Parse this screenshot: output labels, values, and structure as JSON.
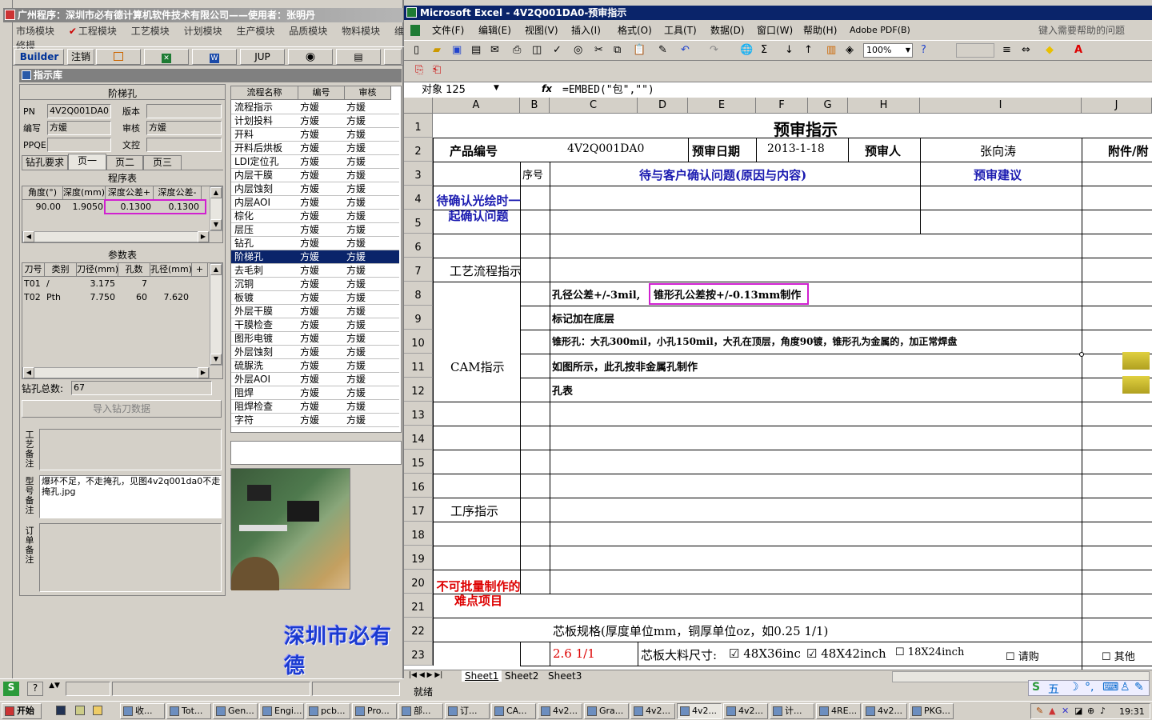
{
  "left": {
    "title": "广州程序：深圳市必有德计算机软件技术有限公司——使用者：张明丹",
    "menu": [
      "市场模块",
      "工程模块",
      "工艺模块",
      "计划模块",
      "生产模块",
      "品质模块",
      "物料模块",
      "维修模"
    ],
    "toolbar": {
      "builder": "Builder",
      "logout": "注销",
      "jup": "JUP"
    },
    "library_title": "指示库",
    "hole_title": "阶梯孔",
    "pn_label": "PN",
    "pn_value": "4V2Q001DA0",
    "version_label": "版本",
    "writer_label": "编写",
    "writer_value": "方媛",
    "reviewer_label": "审核",
    "reviewer_value": "方媛",
    "ppqe_label": "PPQE",
    "doc_label": "文控",
    "tabs": [
      "钻孔要求",
      "页一",
      "页二",
      "页三"
    ],
    "prog_title": "程序表",
    "prog_headers": [
      "角度(°)",
      "深度(mm)",
      "深度公差+",
      "深度公差-"
    ],
    "prog_row": [
      "90.00",
      "1.9050",
      "0.1300",
      "0.1300"
    ],
    "param_title": "参数表",
    "param_headers": [
      "刀号",
      "类别",
      "刀径(mm)",
      "孔数",
      "孔径(mm)",
      "+"
    ],
    "param_rows": [
      [
        "T01",
        "/",
        "3.175",
        "7",
        ""
      ],
      [
        "T02",
        "Pth",
        "7.750",
        "60",
        "7.620"
      ]
    ],
    "drill_total_label": "钻孔总数:",
    "drill_total": "67",
    "import_button": "导入钻刀数据",
    "remark_labels": [
      "工艺备注",
      "型号备注",
      "订单备注"
    ],
    "model_remark": "爆环不足，不走掩孔，见图4v2q001da0不走掩孔.jpg",
    "flow_headers": [
      "流程名称",
      "编号",
      "审核"
    ],
    "flow": [
      [
        "流程指示",
        "方媛",
        "方媛"
      ],
      [
        "计划投料",
        "方媛",
        "方媛"
      ],
      [
        "开料",
        "方媛",
        "方媛"
      ],
      [
        "开料后烘板",
        "方媛",
        "方媛"
      ],
      [
        "LDI定位孔",
        "方媛",
        "方媛"
      ],
      [
        "内层干膜",
        "方媛",
        "方媛"
      ],
      [
        "内层蚀刻",
        "方媛",
        "方媛"
      ],
      [
        "内层AOI",
        "方媛",
        "方媛"
      ],
      [
        "棕化",
        "方媛",
        "方媛"
      ],
      [
        "层压",
        "方媛",
        "方媛"
      ],
      [
        "钻孔",
        "方媛",
        "方媛"
      ],
      [
        "阶梯孔",
        "方媛",
        "方媛"
      ],
      [
        "去毛刺",
        "方媛",
        "方媛"
      ],
      [
        "沉铜",
        "方媛",
        "方媛"
      ],
      [
        "板镀",
        "方媛",
        "方媛"
      ],
      [
        "外层干膜",
        "方媛",
        "方媛"
      ],
      [
        "干膜检查",
        "方媛",
        "方媛"
      ],
      [
        "图形电镀",
        "方媛",
        "方媛"
      ],
      [
        "外层蚀刻",
        "方媛",
        "方媛"
      ],
      [
        "硫脲洗",
        "方媛",
        "方媛"
      ],
      [
        "外层AOI",
        "方媛",
        "方媛"
      ],
      [
        "阻焊",
        "方媛",
        "方媛"
      ],
      [
        "阻焊检查",
        "方媛",
        "方媛"
      ],
      [
        "字符",
        "方媛",
        "方媛"
      ]
    ],
    "selected_flow_index": 11,
    "company_watermark": "深圳市必有德"
  },
  "excel": {
    "title": "Microsoft Excel - 4V2Q001DA0-预审指示",
    "menu": [
      "文件(F)",
      "编辑(E)",
      "视图(V)",
      "插入(I)",
      "格式(O)",
      "工具(T)",
      "数据(D)",
      "窗口(W)",
      "帮助(H)",
      "Adobe PDF(B)"
    ],
    "help_placeholder": "键入需要帮助的问题",
    "zoom": "100%",
    "name_box": "对象 125",
    "formula": "=EMBED(\"包\",\"\")",
    "columns": [
      "A",
      "B",
      "C",
      "D",
      "E",
      "F",
      "G",
      "H",
      "I",
      "J"
    ],
    "rows": [
      "1",
      "2",
      "3",
      "4",
      "5",
      "6",
      "7",
      "8",
      "9",
      "10",
      "11",
      "12",
      "13",
      "14",
      "15",
      "16",
      "17",
      "18",
      "19",
      "20",
      "21",
      "22",
      "23"
    ],
    "sheet_title": "预审指示",
    "product_no_label": "产品编号",
    "product_no": "4V2Q001DA0",
    "review_date_label": "预审日期",
    "review_date": "2013-1-18",
    "reviewer_label": "预审人",
    "reviewer": "张向涛",
    "attach_label": "附件/附",
    "seq_label": "序号",
    "confirm_issue_label": "待与客户确认问题(原因与内容)",
    "suggest_label": "预审建议",
    "pending_label": "待确认光绘时一起确认问题",
    "flow_label": "工艺流程指示",
    "cam_label": "CAM指示",
    "cam_items": [
      "孔径公差+/-3mil,",
      "标记加在底层",
      "锥形孔：大孔300mil，小孔150mil，大孔在顶层，角度90镀，锥形孔为金属的，加正常焊盘",
      "如图所示，此孔按非金属孔制作",
      "孔表"
    ],
    "cam_item1_extra": "锥形孔公差按+/-0.13mm制作",
    "process_label": "工序指示",
    "difficult_label": "不可批量制作的难点项目",
    "core_spec_label": "芯板规格(厚度单位mm，铜厚单位oz，如0.25 1/1)",
    "core_spec_value": "2.6 1/1",
    "core_size_label": "芯板大料尺寸:",
    "core_options": [
      "48X36inc",
      "48X42inch",
      "18X24inch",
      "请购",
      "其他"
    ],
    "sheets": [
      "Sheet1",
      "Sheet2",
      "Sheet3"
    ],
    "status": "就绪",
    "ime": "五"
  },
  "taskbar": {
    "start": "开始",
    "items": [
      "收...",
      "Tot...",
      "Gen...",
      "Engi...",
      "pcb...",
      "Pro...",
      "部...",
      "订...",
      "CA...",
      "4v2...",
      "Gra...",
      "4v2...",
      "4v2...",
      "4v2...",
      "计...",
      "4RE...",
      "4v2...",
      "PKG..."
    ],
    "clock": "19:31"
  }
}
